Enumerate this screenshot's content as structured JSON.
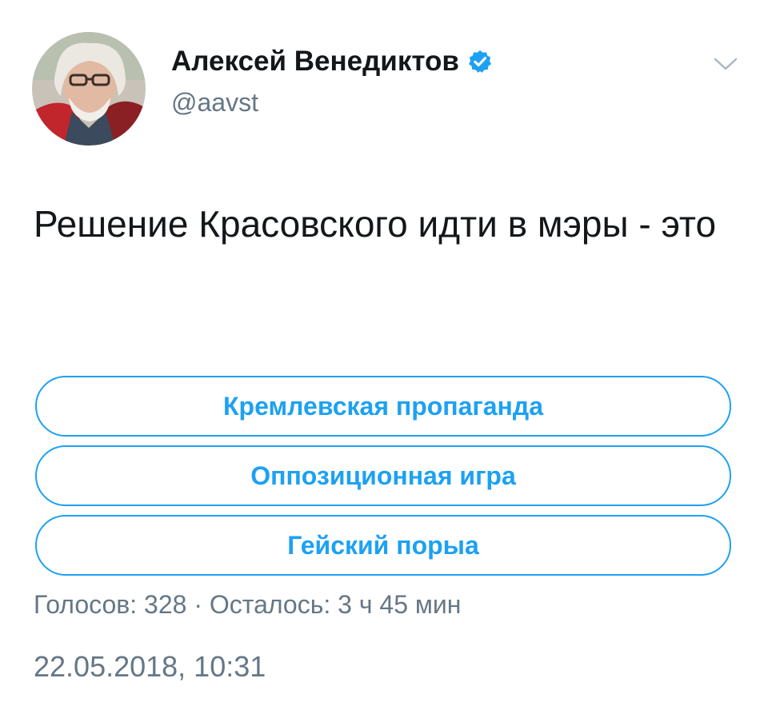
{
  "author": {
    "display_name": "Алексей Венедиктов",
    "handle": "@aavst",
    "verified": true,
    "avatar_icon": "profile-photo"
  },
  "tweet": {
    "text": "Решение Красовского идти в мэры - это"
  },
  "poll": {
    "options": [
      {
        "label": "Кремлевская пропаганда"
      },
      {
        "label": "Оппозиционная игра"
      },
      {
        "label": "Гейский порыа"
      }
    ],
    "votes_label": "Голосов: 328",
    "separator": " · ",
    "time_left_label": "Осталось: 3 ч 45 мин"
  },
  "timestamp": "22.05.2018, 10:31",
  "colors": {
    "accent": "#1da1f2",
    "text_primary": "#14171a",
    "text_secondary": "#657786"
  },
  "icons": {
    "verified": "verified-badge-icon",
    "menu": "chevron-down-icon"
  }
}
